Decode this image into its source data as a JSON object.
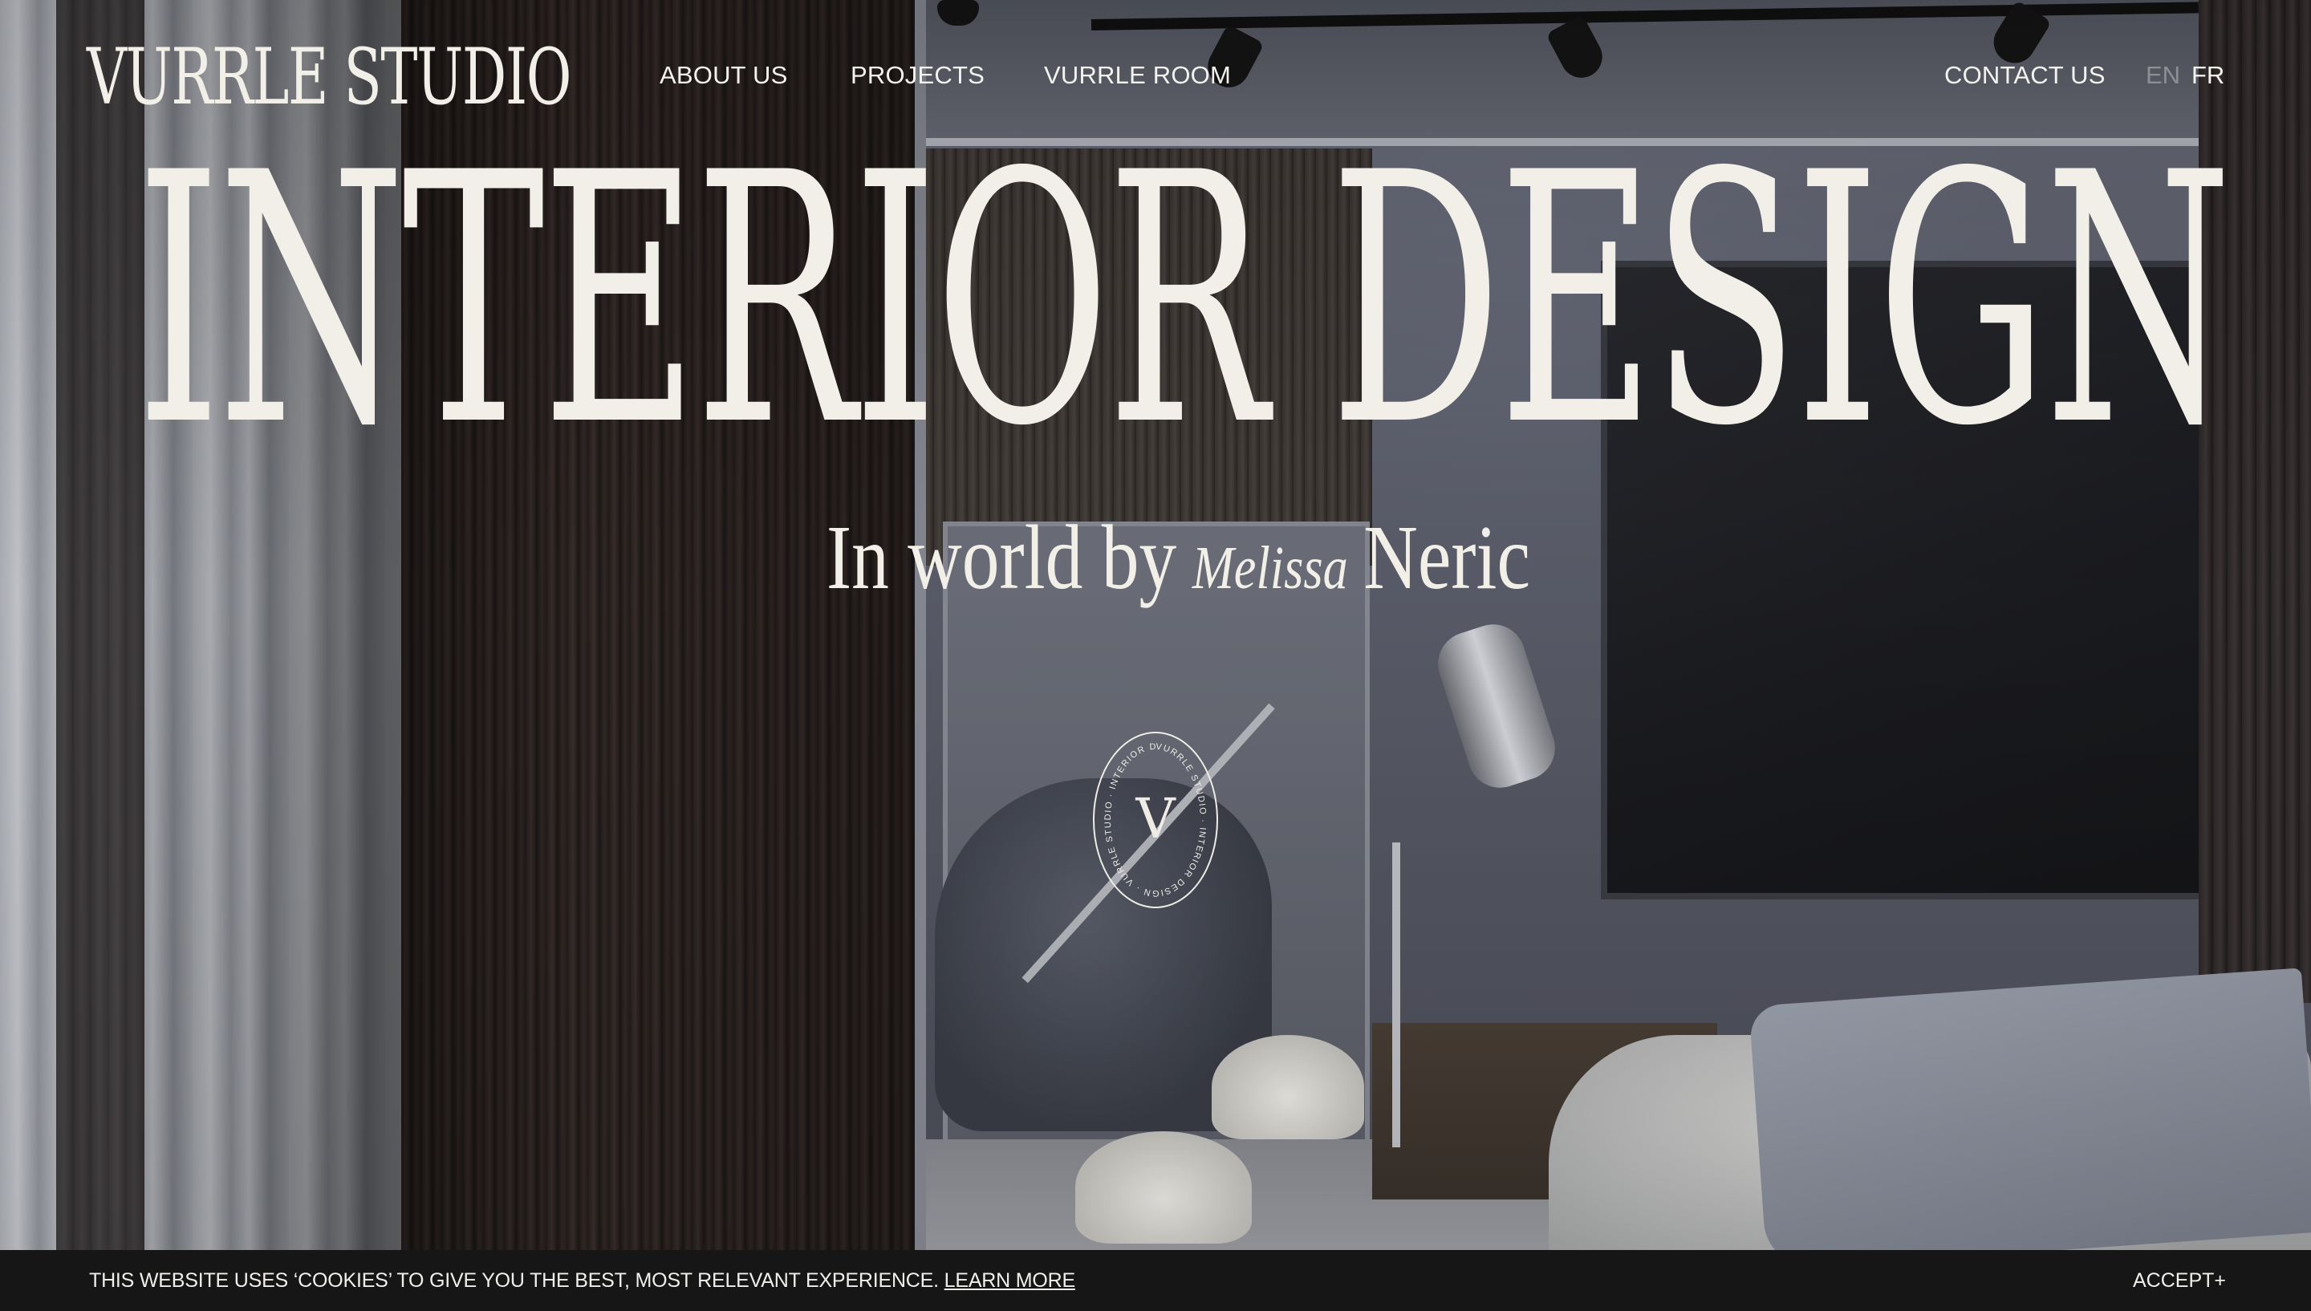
{
  "brand": {
    "logo_text": "VURRLE STUDIO"
  },
  "nav": {
    "items": [
      {
        "label": "ABOUT US"
      },
      {
        "label": "PROJECTS"
      },
      {
        "label": "VURRLE ROOM"
      }
    ],
    "contact_label": "CONTACT US",
    "languages": [
      {
        "code": "EN",
        "active": false
      },
      {
        "code": "FR",
        "active": true
      }
    ]
  },
  "hero": {
    "title": "INTERIOR DESIGN",
    "subtitle_prefix": "In world by",
    "subtitle_italic": "Melissa",
    "subtitle_suffix": "Neric"
  },
  "badge": {
    "letter": "V",
    "ring_text": "VURRLE STUDIO · INTERIOR DESIGN · VURRLE STUDIO · INTERIOR DESIGN ·"
  },
  "cookie": {
    "message": "THIS WEBSITE USES ‘COOKIES’ TO GIVE YOU THE BEST, MOST RELEVANT EXPERIENCE.",
    "learn_more": "LEARN MORE",
    "accept": "ACCEPT+"
  },
  "colors": {
    "text_light": "#f2efe8",
    "lang_inactive": "#8d8f97",
    "cookie_bar": "#161617"
  }
}
